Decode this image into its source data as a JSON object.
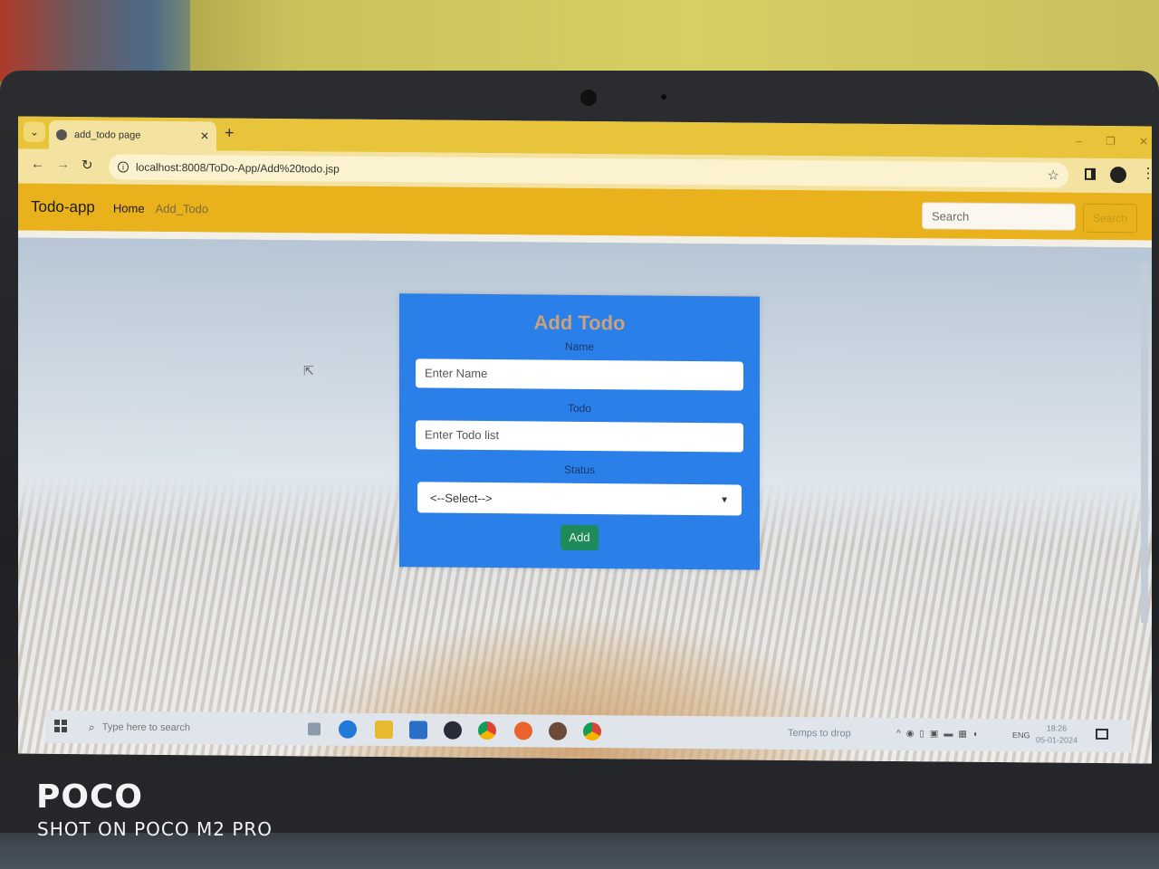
{
  "browser": {
    "tab_title": "add_todo page",
    "new_tab": "+",
    "url": "localhost:8008/ToDo-App/Add%20todo.jsp",
    "window_controls": [
      "–",
      "❐",
      "✕"
    ]
  },
  "navbar": {
    "brand": "Todo-app",
    "links": [
      "Home",
      "Add_Todo"
    ],
    "search_placeholder": "Search",
    "search_button": "Search"
  },
  "form": {
    "title": "Add Todo",
    "name_label": "Name",
    "name_placeholder": "Enter Name",
    "todo_label": "Todo",
    "todo_placeholder": "Enter Todo list",
    "status_label": "Status",
    "status_selected": "<--Select-->",
    "add_button": "Add"
  },
  "taskbar": {
    "search_placeholder": "Type here to search",
    "weather": "Temps to drop",
    "language": "ENG",
    "time": "18:26",
    "date": "05-01-2024"
  },
  "watermark": {
    "brand": "POCO",
    "caption": "SHOT ON POCO M2 PRO"
  },
  "colors": {
    "navbar": "#e9b21c",
    "card": "#2a7fe8",
    "add_button": "#1f8a5a"
  }
}
